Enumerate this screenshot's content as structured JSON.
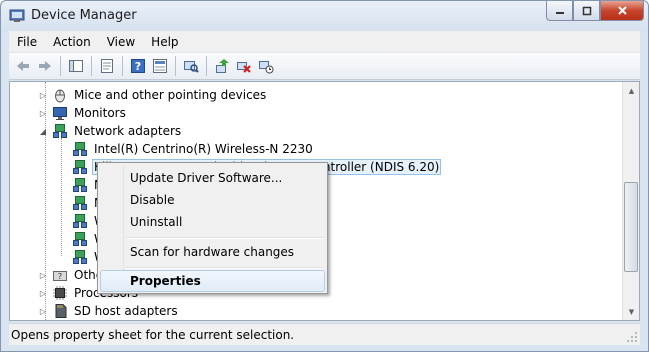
{
  "window": {
    "title": "Device Manager",
    "caption_icons": [
      "minimize-icon",
      "maximize-icon",
      "close-icon"
    ]
  },
  "menu": [
    "File",
    "Action",
    "View",
    "Help"
  ],
  "toolbar": {
    "buttons": [
      "back-arrow-icon",
      "forward-arrow-icon",
      "show-hide-console-tree-icon",
      "properties-icon",
      "help-icon",
      "view-icon",
      "scan-hardware-icon",
      "update-driver-icon",
      "uninstall-icon",
      "enable-icon"
    ]
  },
  "tree": {
    "items": [
      {
        "label": "Mice and other pointing devices",
        "icon": "mouse-icon",
        "expander": "collapsed"
      },
      {
        "label": "Monitors",
        "icon": "monitor-icon",
        "expander": "collapsed"
      },
      {
        "label": "Network adapters",
        "icon": "network-adapter-icon",
        "expander": "expanded"
      },
      {
        "label": "Intel(R) Centrino(R) Wireless-N 2230",
        "icon": "network-adapter-icon"
      },
      {
        "label": "Killer e2200 PCI-E Gigabit Ethernet Controller (NDIS 6.20)",
        "icon": "network-adapter-icon",
        "selected": true
      },
      {
        "label": "M",
        "icon": "network-adapter-icon"
      },
      {
        "label": "M",
        "icon": "network-adapter-icon"
      },
      {
        "label": "W",
        "icon": "network-adapter-icon"
      },
      {
        "label": "W",
        "icon": "network-adapter-icon"
      },
      {
        "label": "W",
        "icon": "network-adapter-icon"
      },
      {
        "label": "Other devices",
        "icon": "other-devices-icon",
        "expander": "collapsed"
      },
      {
        "label": "Processors",
        "icon": "processor-icon",
        "expander": "collapsed"
      },
      {
        "label": "SD host adapters",
        "icon": "sd-card-icon",
        "expander": "collapsed"
      }
    ]
  },
  "context_menu": {
    "update_driver": "Update Driver Software...",
    "disable": "Disable",
    "uninstall": "Uninstall",
    "scan": "Scan for hardware changes",
    "properties": "Properties"
  },
  "status": {
    "text": "Opens property sheet for the current selection."
  },
  "colors": {
    "selection": "#e5f1fb",
    "window_frame": "#d9e4f1",
    "close_button": "#c7452c"
  }
}
